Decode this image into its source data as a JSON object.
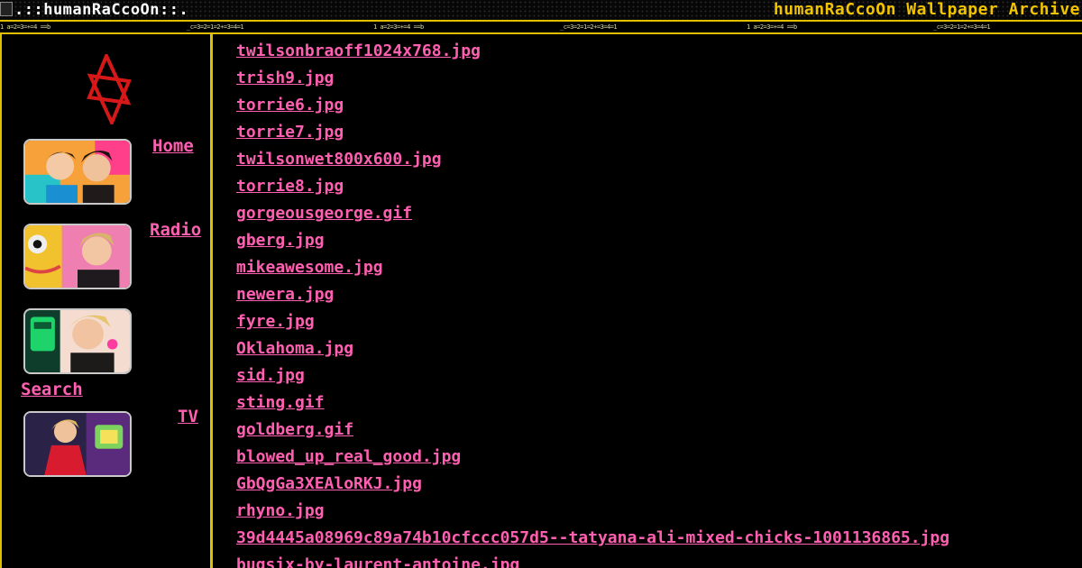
{
  "header": {
    "logo_alt": ".::humanRaCcoOn::.",
    "title": "humanRaCcoOn Wallpaper Archive"
  },
  "ticker": {
    "items": [
      "1 a=2=3=+=4 ==b",
      "_c=3=2=1=2+=3=4=1",
      "1 a=2=3=+=4 ==b",
      "_c=3=2=1=2+=3=4=1",
      "1 a=2=3=+=4 ==b",
      "_c=3=2=1=2+=3=4=1"
    ]
  },
  "nav": {
    "links": [
      {
        "label": "Home"
      },
      {
        "label": "Radio"
      },
      {
        "label": "Search"
      },
      {
        "label": "TV"
      }
    ]
  },
  "files": [
    "twilsonbraoff1024x768.jpg",
    "trish9.jpg",
    "torrie6.jpg",
    "torrie7.jpg",
    "twilsonwet800x600.jpg",
    "torrie8.jpg",
    "gorgeousgeorge.gif",
    "gberg.jpg",
    "mikeawesome.jpg",
    "newera.jpg",
    "fyre.jpg",
    "Oklahoma.jpg",
    "sid.jpg",
    "sting.gif",
    "goldberg.gif",
    "blowed_up_real_good.jpg",
    "GbQgGa3XEAloRKJ.jpg",
    "rhyno.jpg",
    "39d4445a08969c89a74b10cfccc057d5--tatyana-ali-mixed-chicks-1001136865.jpg",
    "bugsix-by-laurent-antoine.jpg"
  ],
  "colors": {
    "accent": "#e0c000",
    "link": "#ff5fb0",
    "background": "#000000"
  }
}
